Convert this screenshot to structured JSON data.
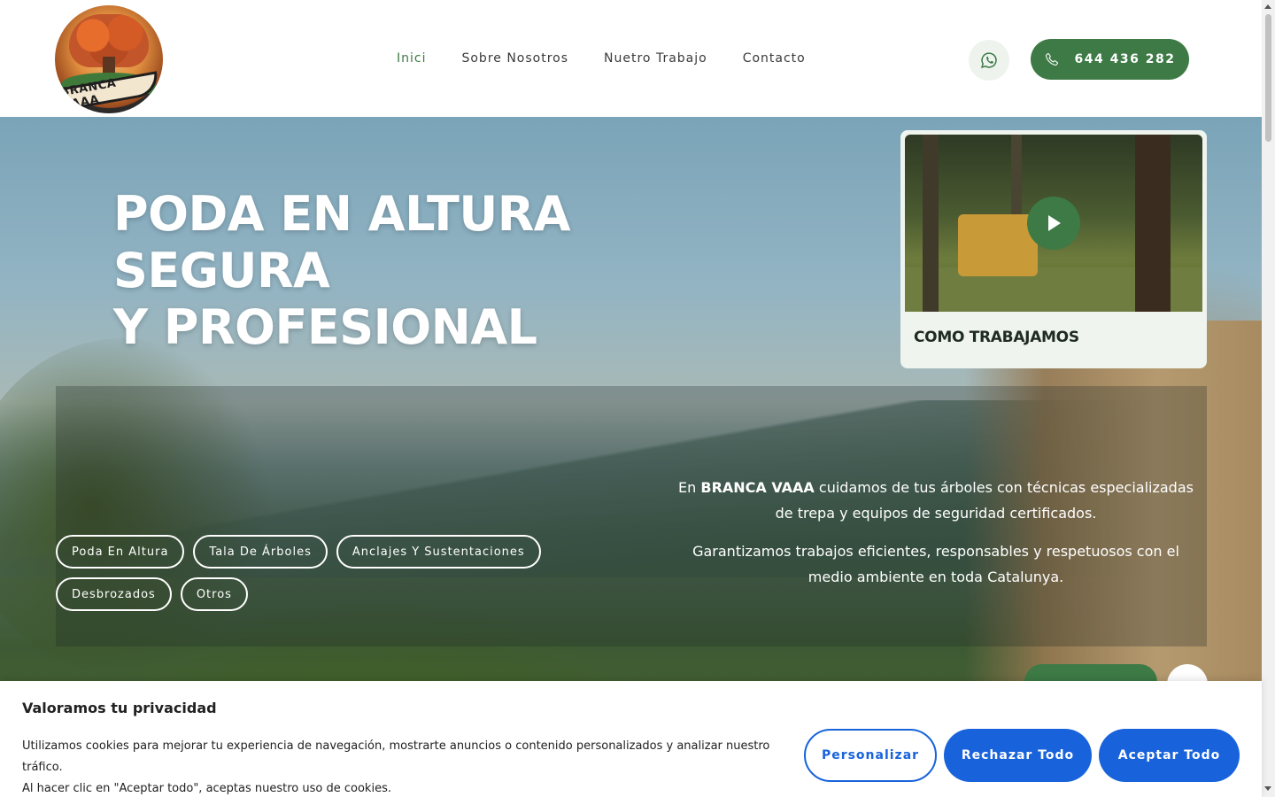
{
  "brand": {
    "logo_text": "BRANCA VAAA"
  },
  "nav": {
    "items": [
      {
        "label": "Inici",
        "active": true
      },
      {
        "label": "Sobre Nosotros",
        "active": false
      },
      {
        "label": "Nuetro Trabajo",
        "active": false
      },
      {
        "label": "Contacto",
        "active": false
      }
    ]
  },
  "header": {
    "phone_label": "644 436 282"
  },
  "hero": {
    "title_line1": "PODA EN ALTURA SEGURA",
    "title_line2": "Y PROFESIONAL",
    "video_card": {
      "label": "COMO TRABAJAMOS"
    },
    "intro_prefix": "En ",
    "intro_brand": "BRANCA VAAA",
    "intro_rest": " cuidamos de tus árboles con técnicas especializadas de trepa y equipos de seguridad certificados.",
    "intro_2": "Garantizamos trabajos eficientes, responsables y respetuosos con el medio ambiente en toda Catalunya.",
    "chips": [
      "Poda En Altura",
      "Tala De Árboles",
      "Anclajes Y Sustentaciones",
      "Desbrozados",
      "Otros"
    ]
  },
  "cookie": {
    "title": "Valoramos tu privacidad",
    "text_line1": "Utilizamos cookies para mejorar tu experiencia de navegación, mostrarte anuncios o contenido personalizados y analizar nuestro tráfico.",
    "text_line2": "Al hacer clic en \"Aceptar todo\", aceptas nuestro uso de cookies.",
    "customize_label": "Personalizar",
    "reject_label": "Rechazar Todo",
    "accept_label": "Aceptar Todo"
  },
  "colors": {
    "brand_green": "#3d7a45",
    "cookie_blue": "#1863dc"
  },
  "icons": {
    "whatsapp": "whatsapp-icon",
    "phone": "phone-icon",
    "play": "play-icon"
  }
}
